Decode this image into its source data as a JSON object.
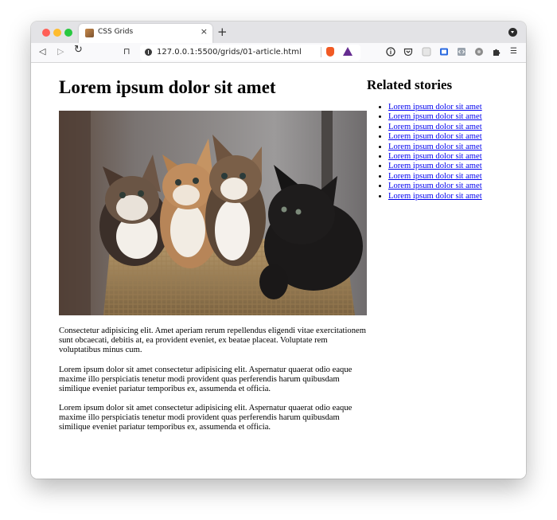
{
  "browser": {
    "tab_title": "CSS Grids",
    "tab_close": "×",
    "new_tab": "+",
    "url": "127.0.0.1:5500/grids/01-article.html",
    "nav": {
      "back": "◁",
      "forward": "▷",
      "reload": "↻",
      "bookmark": "⊓"
    },
    "menu": "☰"
  },
  "article": {
    "heading": "Lorem ipsum dolor sit amet",
    "image_alt": "Four kittens sitting in a woven basket",
    "paragraphs": [
      "Consectetur adipisicing elit. Amet aperiam rerum repellendus eligendi vitae exercitationem sunt obcaecati, debitis at, ea provident eveniet, ex beatae placeat. Voluptate rem voluptatibus minus cum.",
      "Lorem ipsum dolor sit amet consectetur adipisicing elit. Aspernatur quaerat odio eaque maxime illo perspiciatis tenetur modi provident quas perferendis harum quibusdam similique eveniet pariatur temporibus ex, assumenda et officia.",
      "Lorem ipsum dolor sit amet consectetur adipisicing elit. Aspernatur quaerat odio eaque maxime illo perspiciatis tenetur modi provident quas perferendis harum quibusdam similique eveniet pariatur temporibus ex, assumenda et officia."
    ]
  },
  "sidebar": {
    "heading": "Related stories",
    "stories": [
      "Lorem ipsum dolor sit amet",
      "Lorem ipsum dolor sit amet",
      "Lorem ipsum dolor sit amet",
      "Lorem ipsum dolor sit amet",
      "Lorem ipsum dolor sit amet",
      "Lorem ipsum dolor sit amet",
      "Lorem ipsum dolor sit amet",
      "Lorem ipsum dolor sit amet",
      "Lorem ipsum dolor sit amet",
      "Lorem ipsum dolor sit amet"
    ]
  },
  "colors": {
    "link": "#0000ee",
    "tabbar": "#e3e3e6",
    "close": "#ff5f57",
    "minimize": "#febc2e",
    "maximize": "#28c840"
  }
}
